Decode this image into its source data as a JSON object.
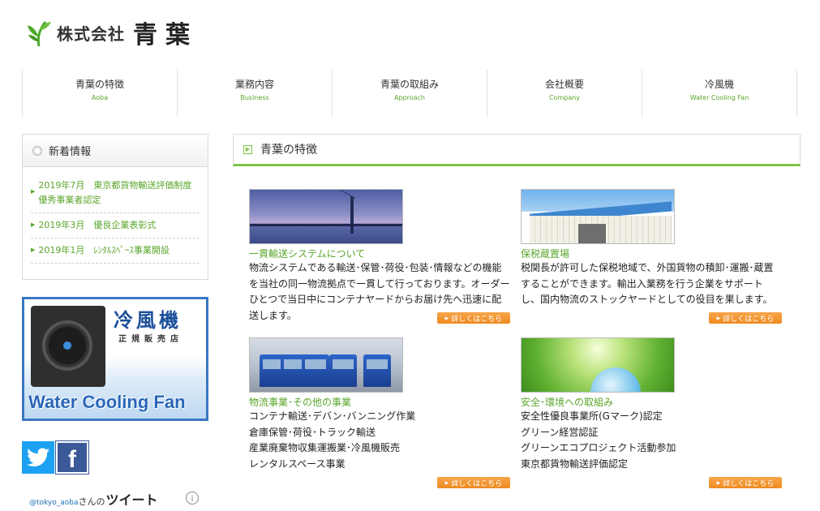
{
  "logo": {
    "company_type": "株式会社",
    "name": "青葉"
  },
  "nav": [
    {
      "jp": "青葉の特徴",
      "en": "Aoba"
    },
    {
      "jp": "業務内容",
      "en": "Business"
    },
    {
      "jp": "青葉の取組み",
      "en": "Approach"
    },
    {
      "jp": "会社概要",
      "en": "Company"
    },
    {
      "jp": "冷風機",
      "en": "Water Cooling Fan"
    }
  ],
  "news": {
    "title": "新着情報",
    "items": [
      "2019年7月　東京都貨物輸送評価制度優秀事業者認定",
      "2019年3月　優良企業表彰式",
      "2019年1月　ﾚﾝﾀﾙｽﾍﾟｰｽ事業開設"
    ]
  },
  "banner": {
    "jp": "冷風機",
    "sub": "正規販売店",
    "en": "Water Cooling Fan"
  },
  "social": {
    "facebook_glyph": "f",
    "tweet_handle": "@tokyo_aoba",
    "tweet_san": "さんの",
    "tweet_word": "ツイート",
    "info_glyph": "i"
  },
  "section": {
    "title": "青葉の特徴"
  },
  "more_label": "詳しくはこちら",
  "cards": [
    {
      "title": "一貫輸送システムについて",
      "body": "物流システムである輸送･保管･荷役･包装･情報などの機能を当社の同一物流拠点で一貫して行っております。オーダーひとつで当日中にコンテナヤードからお届け先へ迅速に配送します。"
    },
    {
      "title": "保税蔵置場",
      "body": "税関長が許可した保税地域で、外国貨物の積卸･運搬･蔵置することができます。輸出入業務を行う企業をサポートし、国内物流のストックヤードとしての役目を果します。"
    },
    {
      "title": "物流事業･その他の事業",
      "lines": [
        "コンテナ輸送･デバン･バンニング作業",
        "倉庫保管･荷役･トラック輸送",
        "産業廃棄物収集運搬業･冷風機販売",
        "レンタルスペース事業"
      ]
    },
    {
      "title": "安全･環境への取組み",
      "lines": [
        "安全性優良事業所(Gマーク)認定",
        "グリーン経営認証",
        "グリーンエコプロジェクト活動参加",
        "東京都貨物輸送評価認定"
      ]
    }
  ],
  "colors": {
    "accent_green": "#5aa52a",
    "line_green": "#7fc44a",
    "more_orange": "#ee8a20",
    "banner_blue": "#3a78c2"
  }
}
